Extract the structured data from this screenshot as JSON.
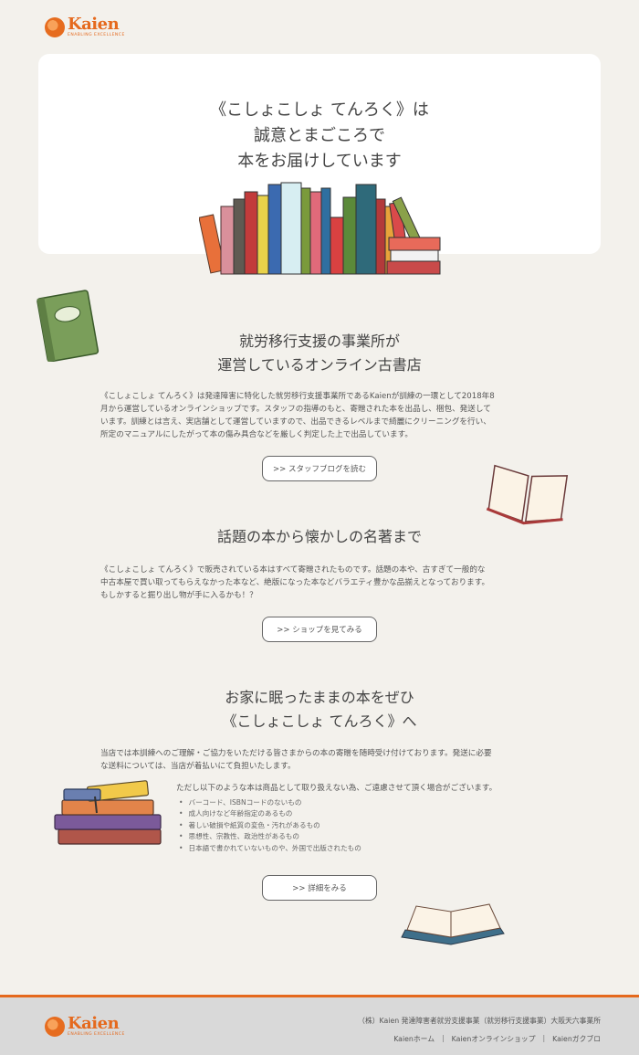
{
  "brand": {
    "name": "Kaien",
    "tagline": "ENABLING EXCELLENCE",
    "accent": "#e5691d"
  },
  "hero": {
    "lines": [
      "《こしょこしょ てんろく》は",
      "誠意とまごころで",
      "本をお届けしています"
    ]
  },
  "section1": {
    "title_lines": [
      "就労移行支援の事業所が",
      "運営しているオンライン古書店"
    ],
    "body_lines": [
      "《こしょこしょ てんろく》は発達障害に特化した就労移行支援事業所であるKaienが訓練の一環として2018年8",
      "月から運営しているオンラインショップです。スタッフの指導のもと、寄贈された本を出品し、梱包、発送して",
      "います。訓練とは言え、実店舗として運営していますので、出品できるレベルまで綺麗にクリーニングを行い、",
      "所定のマニュアルにしたがって本の傷み具合などを厳しく判定した上で出品しています。"
    ],
    "button": ">> スタッフブログを読む"
  },
  "section2": {
    "title_lines": [
      "話題の本から懐かしの名著まで"
    ],
    "body_lines": [
      "《こしょこしょ てんろく》で販売されている本はすべて寄贈されたものです。話題の本や、古すぎて一般的な",
      "中古本屋で買い取ってもらえなかった本など、絶版になった本などバラエティ豊かな品揃えとなっております。",
      "もしかすると掘り出し物が手に入るかも！？"
    ],
    "button": ">> ショップを見てみる"
  },
  "section3": {
    "title_lines": [
      "お家に眠ったままの本をぜひ",
      "《こしょこしょ てんろく》へ"
    ],
    "body_lines": [
      "当店では本訓練へのご理解・ご協力をいただける皆さまからの本の寄贈を随時受け付けております。発送に必要",
      "な送料については、当店が着払いにて負担いたします。"
    ],
    "note": "ただし以下のような本は商品として取り扱えない為、ご遠慮させて頂く場合がございます。",
    "bullets": [
      "バーコード、ISBNコードのないもの",
      "成人向けなど年齢指定のあるもの",
      "著しい破損や紙質の変色・汚れがあるもの",
      "思想性、宗教性、政治性があるもの",
      "日本語で書かれていないものや、外国で出版されたもの"
    ],
    "button": ">> 詳細をみる"
  },
  "footer": {
    "company": "（株）Kaien 発達障害者就労支援事業（就労移行支援事業）大阪天六事業所",
    "links": [
      "Kaienホーム",
      "Kaienオンラインショップ",
      "Kaienガクブロ"
    ],
    "separator": "|"
  }
}
